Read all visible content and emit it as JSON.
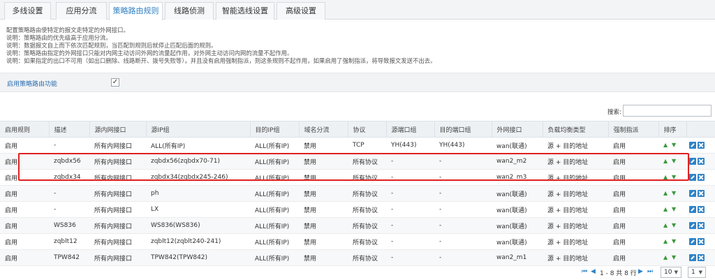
{
  "tabs": [
    {
      "label": "多线设置"
    },
    {
      "label": "应用分流"
    },
    {
      "label": "策略路由规则"
    },
    {
      "label": "线路侦测"
    },
    {
      "label": "智能选线设置"
    },
    {
      "label": "高级设置"
    }
  ],
  "notes": [
    "配置策略路由使特定的报文走特定的外网接口。",
    "说明：策略路由的优先级高于应用分流。",
    "说明：数据报文自上而下依次匹配规则，当匹配到规则后就停止匹配后面的规则。",
    "说明：策略路由指定的外网接口只能对内网主动访问外网的流量起作用，对外网主动访问内网的流量不起作用。",
    "说明：如果指定的出口不可用（如出口删除、线路断开、拨号失败等），并且没有启用强制指派，则这条规则不起作用，如果启用了强制指派，将导致报文发送不出去。"
  ],
  "enable": {
    "label": "启用策略路由功能",
    "mark": "✓"
  },
  "search": {
    "label": "搜索:",
    "value": ""
  },
  "table": {
    "headers": [
      "启用规则",
      "描述",
      "源内网接口",
      "源IP组",
      "目的IP组",
      "域名分流",
      "协议",
      "源端口组",
      "目的端口组",
      "外网接口",
      "负载均衡类型",
      "强制指派",
      "排序",
      ""
    ],
    "rows": [
      [
        "启用",
        "-",
        "所有内网接口",
        "ALL(所有IP)",
        "ALL(所有IP)",
        "禁用",
        "TCP",
        "YH(443)",
        "YH(443)",
        "wan(联通)",
        "源 + 目的地址",
        "启用"
      ],
      [
        "启用",
        "zqbdx56",
        "所有内网接口",
        "zqbdx56(zqbdx70-71)",
        "ALL(所有IP)",
        "禁用",
        "所有协议",
        "-",
        "-",
        "wan2_m2",
        "源 + 目的地址",
        "启用"
      ],
      [
        "启用",
        "zqbdx34",
        "所有内网接口",
        "zqbdx34(zqbdx245-246)",
        "ALL(所有IP)",
        "禁用",
        "所有协议",
        "-",
        "-",
        "wan2_m3",
        "源 + 目的地址",
        "启用"
      ],
      [
        "启用",
        "-",
        "所有内网接口",
        "ph",
        "ALL(所有IP)",
        "禁用",
        "所有协议",
        "-",
        "-",
        "wan(联通)",
        "源 + 目的地址",
        "启用"
      ],
      [
        "启用",
        "-",
        "所有内网接口",
        "LX",
        "ALL(所有IP)",
        "禁用",
        "所有协议",
        "-",
        "-",
        "wan(联通)",
        "源 + 目的地址",
        "启用"
      ],
      [
        "启用",
        "WS836",
        "所有内网接口",
        "WS836(WS836)",
        "ALL(所有IP)",
        "禁用",
        "所有协议",
        "-",
        "-",
        "wan(联通)",
        "源 + 目的地址",
        "启用"
      ],
      [
        "启用",
        "zqblt12",
        "所有内网接口",
        "zqblt12(zqblt240-241)",
        "ALL(所有IP)",
        "禁用",
        "所有协议",
        "-",
        "-",
        "wan(联通)",
        "源 + 目的地址",
        "启用"
      ],
      [
        "启用",
        "TPW842",
        "所有内网接口",
        "TPW842(TPW842)",
        "ALL(所有IP)",
        "禁用",
        "所有协议",
        "-",
        "-",
        "wan2_m1",
        "源 + 目的地址",
        "启用"
      ]
    ],
    "sort_icons": {
      "up": "▲",
      "down": "▼"
    }
  },
  "pagination": {
    "summary": "1 - 8 共 8 行",
    "first": "⏮",
    "prev": "◀",
    "next": "▶",
    "last": "⏭",
    "page_size": "10",
    "page": "1",
    "caret": "▼"
  },
  "colors": {
    "accent": "#2f83c7",
    "highlight": "#e02020",
    "sort_arrow": "#3a9a3a"
  }
}
